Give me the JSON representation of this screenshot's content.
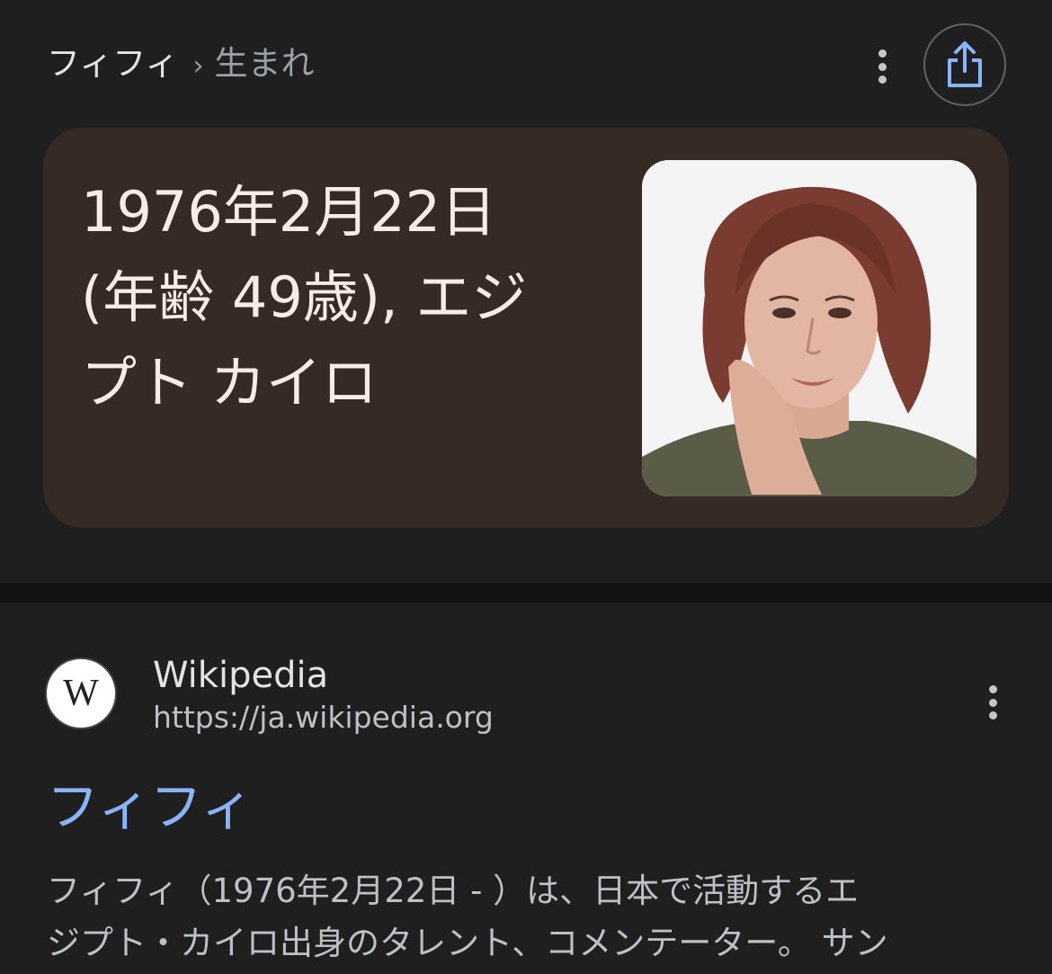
{
  "breadcrumb": {
    "root": "フィフィ",
    "separator": "›",
    "leaf": "生まれ"
  },
  "answer_card": {
    "lines": [
      "1976年2月22日",
      "(年齢 49歳), エジ",
      "プト カイロ"
    ],
    "photo": "portrait-photo"
  },
  "result": {
    "site_name": "Wikipedia",
    "site_url": "https://ja.wikipedia.org",
    "logo_text": "W",
    "title": "フィフィ",
    "snippet_lines": [
      "フィフィ（1976年2月22日 - ）は、日本で活動するエ",
      "ジプト・カイロ出身のタレント、コメンテーター。 サン"
    ]
  },
  "icons": {
    "menu": "more-vert-icon",
    "share": "share-icon"
  },
  "colors": {
    "background": "#1f1f1f",
    "card_background": "#362a25",
    "link": "#8ab4f8",
    "share_icon": "#8ab4f8"
  }
}
